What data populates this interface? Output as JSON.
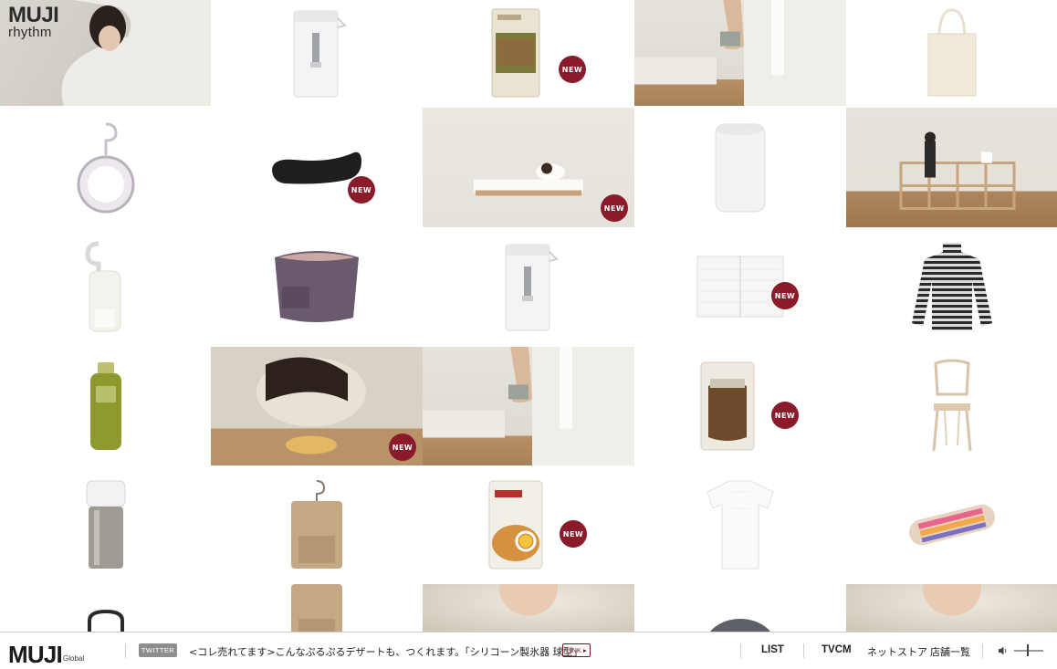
{
  "brand": {
    "name": "MUJI",
    "sub": "rhythm"
  },
  "badges": {
    "new": "NEW"
  },
  "footer": {
    "logo": "MUJI",
    "region": "Global",
    "twitter_label": "TWITTER",
    "ticker": "<コレ売れてます>こんなぷるぷるデザートも、つくれます。「シリコーン製氷器 球型」",
    "link_label": "LINK ▸",
    "nav": {
      "list": "LIST",
      "tvcm": "TVCM",
      "netstore": "ネットストア",
      "stores": "店舗一覧"
    },
    "volume": {
      "icon": "speaker-icon",
      "level": 0.5
    }
  },
  "tiles": [
    {
      "name": "tile-model-towel",
      "kind": "logo"
    },
    {
      "name": "tile-water-pitcher",
      "kind": "product",
      "icon": "pitcher-icon"
    },
    {
      "name": "tile-curry-pouch",
      "kind": "product",
      "icon": "pouch-icon",
      "new": true
    },
    {
      "name": "tile-stairs-socks-1",
      "kind": "photo",
      "icon": "stairs-photo"
    },
    {
      "name": "tile-tote-bag",
      "kind": "product",
      "icon": "tote-icon"
    },
    {
      "name": "tile-hanging-light",
      "kind": "product",
      "icon": "hanging-light-icon"
    },
    {
      "name": "tile-foot-cover",
      "kind": "product",
      "icon": "foot-cover-icon",
      "new": true
    },
    {
      "name": "tile-bed-lounge",
      "kind": "photo",
      "icon": "bed-photo",
      "new": true
    },
    {
      "name": "tile-humidifier",
      "kind": "product",
      "icon": "humidifier-icon"
    },
    {
      "name": "tile-shelf-room",
      "kind": "photo",
      "icon": "shelf-photo"
    },
    {
      "name": "tile-hook-lamp",
      "kind": "product",
      "icon": "hook-lamp-icon"
    },
    {
      "name": "tile-bag-organizer",
      "kind": "product",
      "icon": "organizer-icon"
    },
    {
      "name": "tile-water-pitcher-2",
      "kind": "product",
      "icon": "pitcher-icon"
    },
    {
      "name": "tile-notebook",
      "kind": "product",
      "icon": "notebook-icon",
      "new": true
    },
    {
      "name": "tile-striped-turtleneck",
      "kind": "product",
      "icon": "turtleneck-icon"
    },
    {
      "name": "tile-toner-bottle",
      "kind": "product",
      "icon": "bottle-icon"
    },
    {
      "name": "tile-cake-decorating",
      "kind": "photo",
      "icon": "cake-photo",
      "new": true
    },
    {
      "name": "tile-stairs-socks-2",
      "kind": "photo",
      "icon": "stairs-photo"
    },
    {
      "name": "tile-snack-bag",
      "kind": "product",
      "icon": "snack-bag-icon",
      "new": true
    },
    {
      "name": "tile-wooden-chair",
      "kind": "product",
      "icon": "chair-icon"
    },
    {
      "name": "tile-tumbler",
      "kind": "product",
      "icon": "tumbler-icon"
    },
    {
      "name": "tile-hanging-pouch",
      "kind": "product",
      "icon": "hanging-pouch-icon"
    },
    {
      "name": "tile-chaplin-pouch",
      "kind": "product",
      "icon": "food-pack-icon",
      "new": true
    },
    {
      "name": "tile-white-tshirts",
      "kind": "product",
      "icon": "tshirt-icon"
    },
    {
      "name": "tile-pencil-case",
      "kind": "product",
      "icon": "pencil-case-icon"
    },
    {
      "name": "tile-bag-handle",
      "kind": "product",
      "icon": "bag-handle-icon"
    },
    {
      "name": "tile-hanging-pouch-2",
      "kind": "product",
      "icon": "hanging-pouch-icon"
    },
    {
      "name": "tile-mother-child",
      "kind": "photo",
      "icon": "portrait-photo"
    },
    {
      "name": "tile-cushion",
      "kind": "product",
      "icon": "cushion-icon"
    },
    {
      "name": "tile-smiling-child",
      "kind": "photo",
      "icon": "portrait-photo"
    }
  ]
}
